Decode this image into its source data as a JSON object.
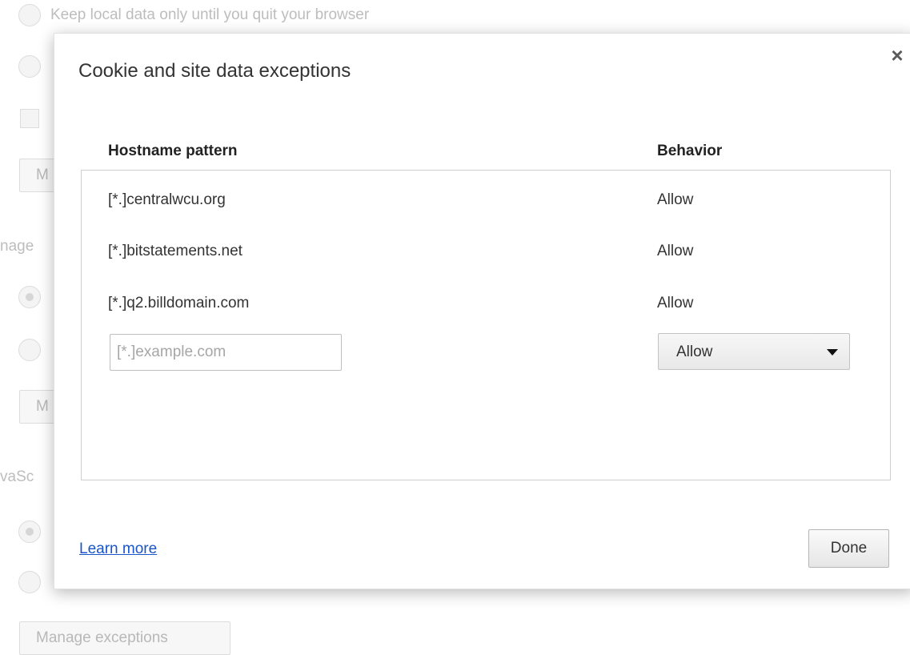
{
  "background": {
    "keep_local_label": "Keep local data only until you quit your browser",
    "images_partial": "nage",
    "javascript_partial": "vaSc",
    "manage_btn_partial": "M",
    "manage_exceptions_label": "Manage exceptions"
  },
  "dialog": {
    "title": "Cookie and site data exceptions",
    "close_glyph": "×",
    "columns": {
      "hostname": "Hostname pattern",
      "behavior": "Behavior"
    },
    "rows": [
      {
        "host": "[*.]centralwcu.org",
        "behavior": "Allow"
      },
      {
        "host": "[*.]bitstatements.net",
        "behavior": "Allow"
      },
      {
        "host": "[*.]q2.billdomain.com",
        "behavior": "Allow"
      }
    ],
    "new_entry": {
      "placeholder": "[*.]example.com",
      "value": "",
      "behavior_selected": "Allow"
    },
    "learn_more": "Learn more",
    "done_label": "Done"
  },
  "colors": {
    "link": "#1a55c9",
    "overlay_text": "#bdbdbd"
  }
}
